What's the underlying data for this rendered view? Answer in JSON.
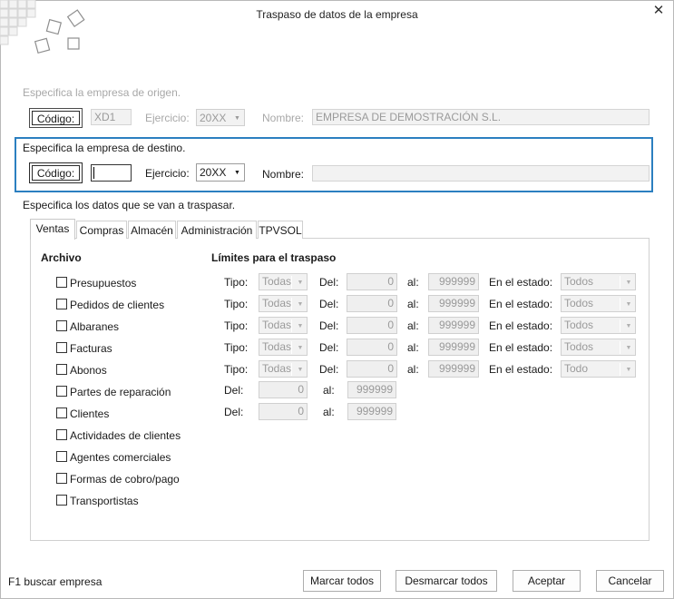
{
  "window": {
    "title": "Traspaso de datos de la empresa",
    "close_symbol": "✕"
  },
  "origin": {
    "heading": "Especifica la empresa de origen.",
    "code_label": "Código:",
    "code_value": "XD1",
    "year_label": "Ejercicio:",
    "year_value": "20XX",
    "name_label": "Nombre:",
    "name_value": "EMPRESA DE DEMOSTRACIÓN S.L."
  },
  "destination": {
    "heading": "Especifica la empresa de destino.",
    "code_label": "Código:",
    "code_value": "",
    "year_label": "Ejercicio:",
    "year_value": "20XX",
    "name_label": "Nombre:",
    "name_value": ""
  },
  "data_heading": "Especifica los datos que se van a traspasar.",
  "tabs": [
    "Ventas",
    "Compras",
    "Almacén",
    "Administración",
    "TPVSOL"
  ],
  "active_tab": "Ventas",
  "archivo_heading": "Archivo",
  "limits_heading": "Límites para el traspaso",
  "archivo_items": [
    "Presupuestos",
    "Pedidos de clientes",
    "Albaranes",
    "Facturas",
    "Abonos",
    "Partes de reparación",
    "Clientes",
    "Actividades de clientes",
    "Agentes comerciales",
    "Formas de cobro/pago",
    "Transportistas"
  ],
  "limit_labels": {
    "tipo": "Tipo:",
    "del": "Del:",
    "al": "al:",
    "estado": "En el estado:"
  },
  "limit_rows": [
    {
      "tipo": "Todas",
      "del": "0",
      "al": "999999",
      "estado": "Todos"
    },
    {
      "tipo": "Todas",
      "del": "0",
      "al": "999999",
      "estado": "Todos"
    },
    {
      "tipo": "Todas",
      "del": "0",
      "al": "999999",
      "estado": "Todos"
    },
    {
      "tipo": "Todas",
      "del": "0",
      "al": "999999",
      "estado": "Todos"
    },
    {
      "tipo": "Todas",
      "del": "0",
      "al": "999999",
      "estado": "Todo"
    }
  ],
  "simple_limit_rows": [
    {
      "del": "0",
      "al": "999999"
    },
    {
      "del": "0",
      "al": "999999"
    }
  ],
  "dropdown_icon": "chevron-down",
  "footer": {
    "hint": "F1 buscar empresa",
    "mark_all": "Marcar todos",
    "unmark_all": "Desmarcar todos",
    "accept": "Aceptar",
    "cancel": "Cancelar"
  },
  "colors": {
    "accent": "#2b7fc0",
    "disabled_text": "#9a9a9a"
  }
}
